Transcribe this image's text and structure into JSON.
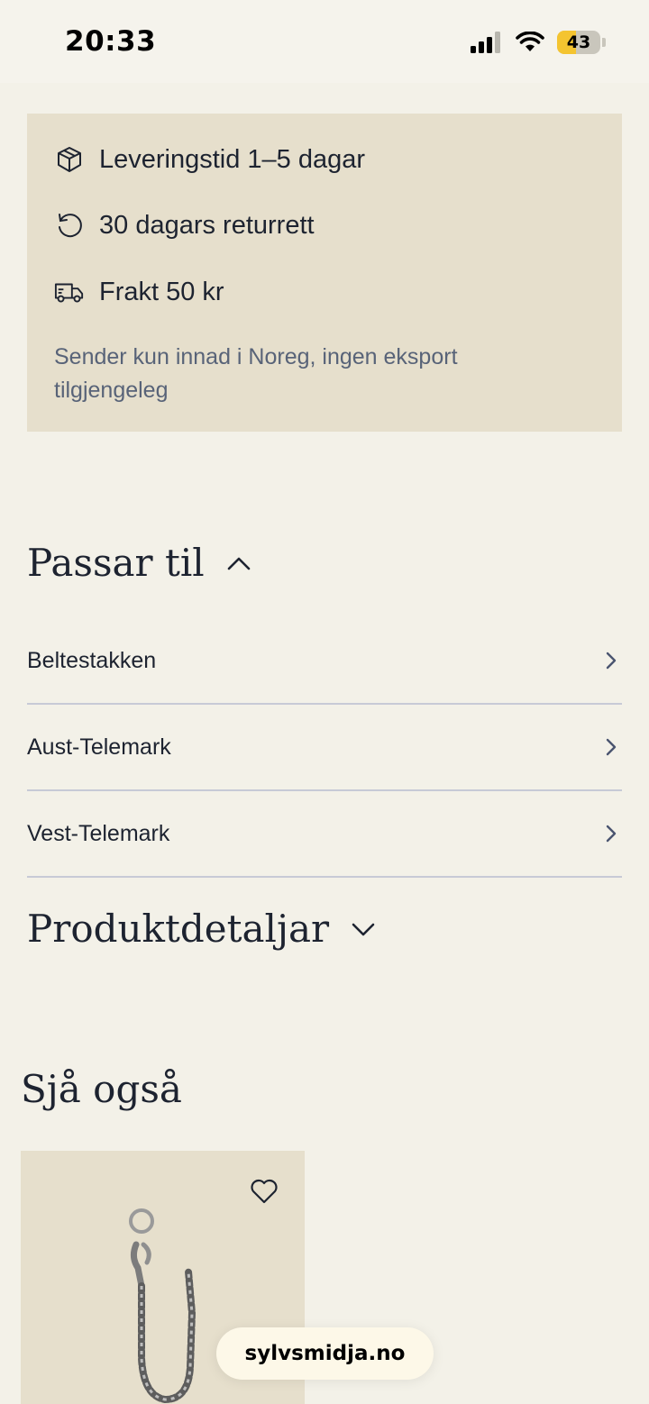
{
  "status_bar": {
    "time": "20:33",
    "battery": "43"
  },
  "delivery": {
    "items": [
      {
        "label": "Leveringstid 1–5 dagar",
        "icon": "package-icon"
      },
      {
        "label": "30 dagars returrett",
        "icon": "return-icon"
      },
      {
        "label": "Frakt 50 kr",
        "icon": "truck-icon"
      }
    ],
    "note": "Sender kun innad i Noreg, ingen eksport tilgjengeleg"
  },
  "passar_til": {
    "title": "Passar til",
    "expanded": true,
    "items": [
      "Beltestakken",
      "Aust-Telemark",
      "Vest-Telemark"
    ]
  },
  "produktdetaljar": {
    "title": "Produktdetaljar",
    "expanded": false
  },
  "see_also": {
    "title": "Sjå også"
  },
  "browser": {
    "url": "sylvsmidja.no"
  },
  "colors": {
    "background": "#f3f1e8",
    "card": "#e6dfcc",
    "text": "#1d2330",
    "muted": "#586378",
    "battery": "#f4c430"
  }
}
